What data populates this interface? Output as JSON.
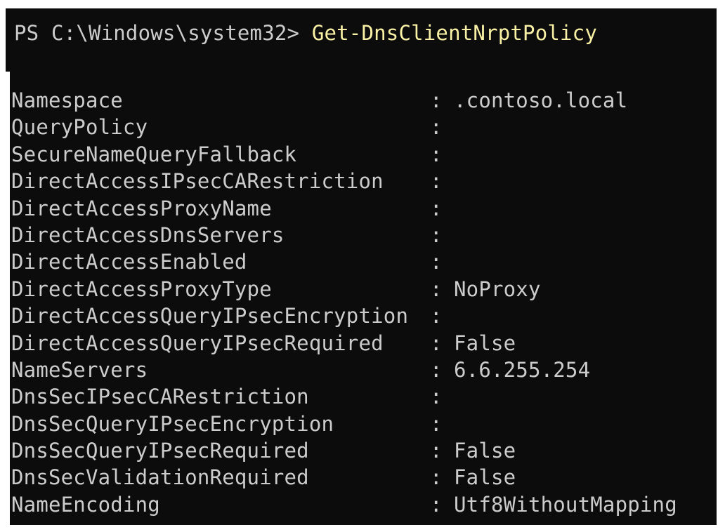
{
  "console": {
    "prompt": "PS C:\\Windows\\system32> ",
    "command": "Get-DnsClientNrptPolicy",
    "separator": ":",
    "properties": [
      {
        "key": "Namespace",
        "value": ".contoso.local"
      },
      {
        "key": "QueryPolicy",
        "value": ""
      },
      {
        "key": "SecureNameQueryFallback",
        "value": ""
      },
      {
        "key": "DirectAccessIPsecCARestriction",
        "value": ""
      },
      {
        "key": "DirectAccessProxyName",
        "value": ""
      },
      {
        "key": "DirectAccessDnsServers",
        "value": ""
      },
      {
        "key": "DirectAccessEnabled",
        "value": ""
      },
      {
        "key": "DirectAccessProxyType",
        "value": "NoProxy"
      },
      {
        "key": "DirectAccessQueryIPsecEncryption",
        "value": ""
      },
      {
        "key": "DirectAccessQueryIPsecRequired",
        "value": "False"
      },
      {
        "key": "NameServers",
        "value": "6.6.255.254"
      },
      {
        "key": "DnsSecIPsecCARestriction",
        "value": ""
      },
      {
        "key": "DnsSecQueryIPsecEncryption",
        "value": ""
      },
      {
        "key": "DnsSecQueryIPsecRequired",
        "value": "False"
      },
      {
        "key": "DnsSecValidationRequired",
        "value": "False"
      },
      {
        "key": "NameEncoding",
        "value": "Utf8WithoutMapping"
      }
    ]
  }
}
